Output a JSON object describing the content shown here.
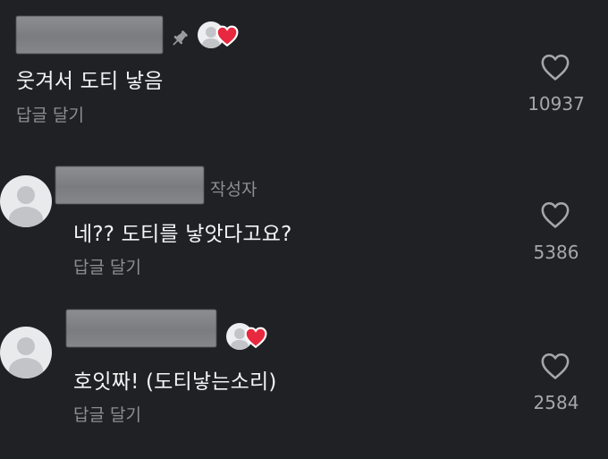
{
  "comments": [
    {
      "text": "웃겨서 도티 낳음",
      "reply_label": "답글 달기",
      "like_count": "10937",
      "pinned": true,
      "creator_liked": true,
      "icons": [
        "pin-icon",
        "heart-outline-icon"
      ]
    },
    {
      "author_tag": "작성자",
      "text": "네?? 도티를 낳앗다고요?",
      "reply_label": "답글 달기",
      "like_count": "5386",
      "icons": [
        "heart-outline-icon"
      ]
    },
    {
      "text": "호잇짜! (도티낳는소리)",
      "reply_label": "답글 달기",
      "like_count": "2584",
      "creator_liked": true,
      "icons": [
        "heart-outline-icon"
      ]
    }
  ],
  "colors": {
    "background": "#1f2125",
    "text": "#f4f4f4",
    "secondary_text": "#8c8e93",
    "heart_accent": "#e8283e",
    "pin_icon": "#9a9ca0"
  }
}
